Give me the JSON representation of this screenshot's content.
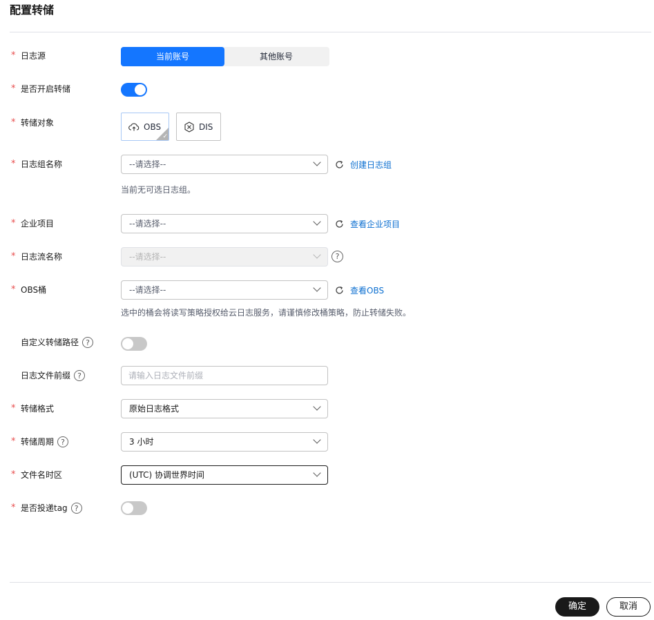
{
  "title": "配置转储",
  "rows": {
    "log_source": {
      "label": "日志源",
      "options": [
        "当前账号",
        "其他账号"
      ],
      "selected": "当前账号"
    },
    "enable_transfer": {
      "label": "是否开启转储",
      "on": true
    },
    "transfer_target": {
      "label": "转储对象",
      "options": [
        "OBS",
        "DIS"
      ],
      "selected": "OBS"
    },
    "log_group": {
      "label": "日志组名称",
      "placeholder": "--请选择--",
      "action": "创建日志组",
      "hint": "当前无可选日志组。"
    },
    "enterprise_project": {
      "label": "企业项目",
      "placeholder": "--请选择--",
      "action": "查看企业项目"
    },
    "log_stream": {
      "label": "日志流名称",
      "placeholder": "--请选择--",
      "help": "?"
    },
    "obs_bucket": {
      "label": "OBS桶",
      "placeholder": "--请选择--",
      "action": "查看OBS",
      "hint": "选中的桶会将读写策略授权给云日志服务，请谨慎修改桶策略，防止转储失败。"
    },
    "custom_path": {
      "label": "自定义转储路径",
      "help": "?",
      "on": false
    },
    "file_prefix": {
      "label": "日志文件前缀",
      "help": "?",
      "placeholder": "请输入日志文件前缀"
    },
    "format": {
      "label": "转储格式",
      "value": "原始日志格式"
    },
    "period": {
      "label": "转储周期",
      "help": "?",
      "value": "3 小时"
    },
    "timezone": {
      "label": "文件名时区",
      "value": "(UTC) 协调世界时间"
    },
    "deliver_tag": {
      "label": "是否投递tag",
      "help": "?",
      "on": false
    }
  },
  "required_mark": "*",
  "buttons": {
    "confirm": "确定",
    "cancel": "取消"
  },
  "colors": {
    "accent": "#1476ff",
    "link": "#0c6fd0",
    "required": "#e84d4d",
    "primary_button": "#191919"
  }
}
